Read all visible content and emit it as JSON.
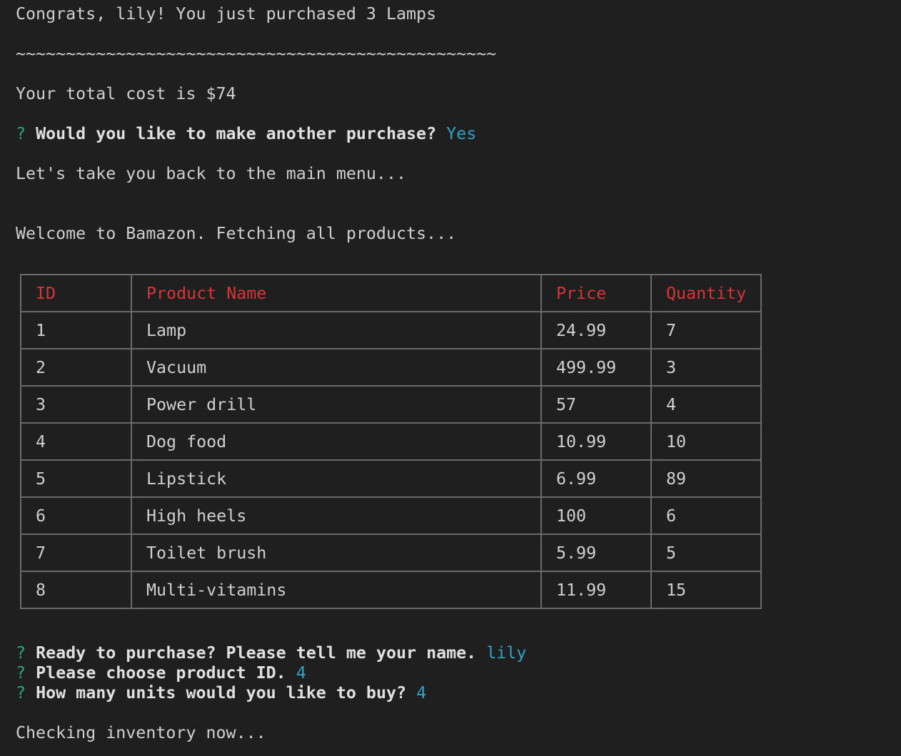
{
  "terminal": {
    "congrats": "Congrats, lily! You just purchased 3 Lamps",
    "separator": "~~~~~~~~~~~~~~~~~~~~~~~~~~~~~~~~~~~~~~~~~~~~~~~~",
    "total_cost": "Your total cost is $74",
    "prompt_marker": "?",
    "another_question": "Would you like to make another purchase?",
    "another_answer": "Yes",
    "back_menu": "Let's take you back to the main menu...",
    "welcome": "Welcome to Bamazon. Fetching all products...",
    "name_question": "Ready to purchase? Please tell me your name.",
    "name_answer": "lily",
    "product_question": "Please choose product ID.",
    "product_answer": "4",
    "units_question": "How many units would you like to buy?",
    "units_answer": "4",
    "checking": "Checking inventory now..."
  },
  "table": {
    "headers": [
      "ID",
      "Product Name",
      "Price",
      "Quantity"
    ],
    "rows": [
      [
        "1",
        "Lamp",
        "24.99",
        "7"
      ],
      [
        "2",
        "Vacuum",
        "499.99",
        "3"
      ],
      [
        "3",
        "Power drill",
        "57",
        "4"
      ],
      [
        "4",
        "Dog food",
        "10.99",
        "10"
      ],
      [
        "5",
        "Lipstick",
        "6.99",
        "89"
      ],
      [
        "6",
        "High heels",
        "100",
        "6"
      ],
      [
        "7",
        "Toilet brush",
        "5.99",
        "5"
      ],
      [
        "8",
        "Multi-vitamins",
        "11.99",
        "15"
      ]
    ]
  },
  "colors": {
    "background": "#1f1f1f",
    "text": "#d0d0d0",
    "prompt_marker": "#2aa876",
    "answer": "#2fa3c8",
    "table_header": "#d8343a",
    "table_border": "#6a6a6a"
  }
}
